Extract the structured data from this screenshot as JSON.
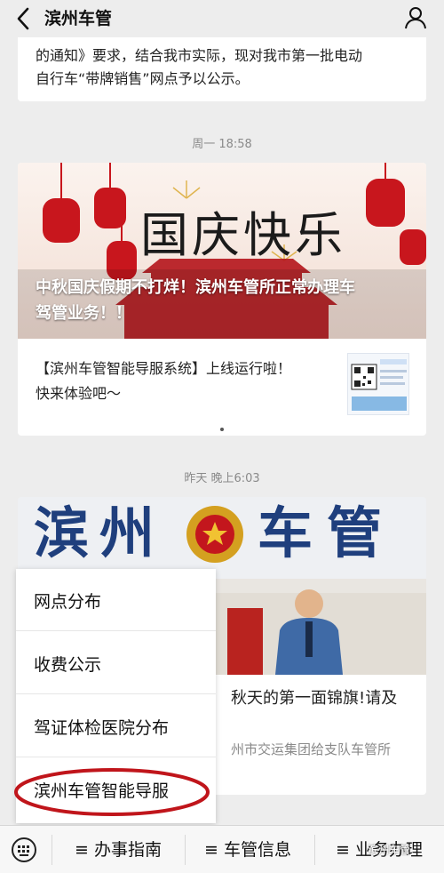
{
  "header": {
    "title": "滨州车管",
    "back_icon": "chevron-left-icon",
    "profile_icon": "person-icon"
  },
  "prev_message": {
    "lines": [
      "的通知》要求，结合我市实际，现对我市第一批电动",
      "自行车“带牌销售”网点予以公示。"
    ]
  },
  "feed": [
    {
      "time": "周一 18:58",
      "banner_art_text": "国庆快乐",
      "banner_caption_lines": [
        "中秋国庆假期不打烊！滨州车管所正常办理车",
        "驾管业务！！"
      ],
      "sub_lines": [
        "【滨州车管智能导服系统】上线运行啦！",
        "快来体验吧～"
      ]
    },
    {
      "time": "昨天 晚上6:03",
      "banner_text": [
        "滨",
        "州",
        "车",
        "管"
      ],
      "title": "秋天的第一面锦旗!请及",
      "subtitle": "州市交运集团给支队车管所"
    }
  ],
  "menu": {
    "items": [
      "网点分布",
      "收费公示",
      "驾证体检医院分布",
      "滨州车管智能导服"
    ],
    "highlight_color": "#c0151b"
  },
  "bottom_menu": {
    "keyboard_icon": "keyboard-icon",
    "items": [
      "≡ 办事指南",
      "≡ 车管信息",
      "≡ 业务办理"
    ],
    "watermark": "滨州车管"
  },
  "colors": {
    "banner_red": "#b5151b",
    "police_blue": "#1f3f7d"
  }
}
